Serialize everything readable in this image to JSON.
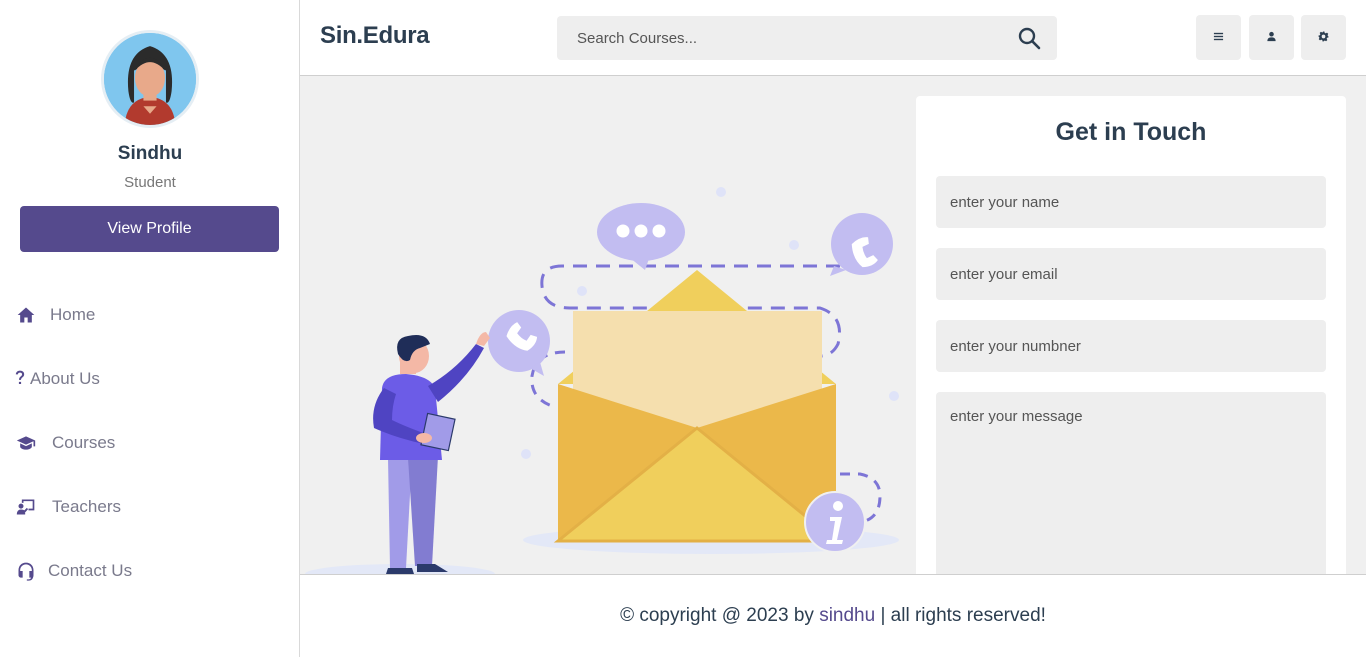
{
  "profile": {
    "name": "Sindhu",
    "role": "Student",
    "view_profile_label": "View Profile"
  },
  "nav": {
    "home": "Home",
    "about": "About Us",
    "courses": "Courses",
    "teachers": "Teachers",
    "contact": "Contact Us"
  },
  "header": {
    "logo": "Sin.Edura",
    "search_placeholder": "Search Courses..."
  },
  "contact_form": {
    "title": "Get in Touch",
    "name_placeholder": "enter your name",
    "email_placeholder": "enter your email",
    "number_placeholder": "enter your numbner",
    "message_placeholder": "enter your message"
  },
  "footer": {
    "prefix": "© copyright @ 2023 by ",
    "brand": "sindhu",
    "suffix": " | all rights reserved!"
  },
  "colors": {
    "accent": "#554a8d",
    "illustration_purple": "#6c5ce7",
    "envelope_yellow": "#f0cf5c"
  },
  "icons": {
    "home": "home-icon",
    "about": "question-icon",
    "courses": "graduation-cap-icon",
    "teachers": "teacher-icon",
    "contact": "headset-icon",
    "search": "search-icon",
    "menu": "menu-icon",
    "user": "user-icon",
    "settings": "gear-icon"
  }
}
